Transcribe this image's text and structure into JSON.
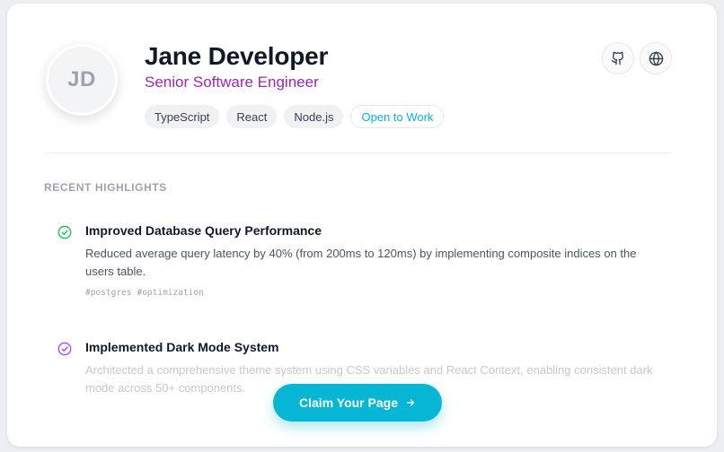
{
  "profile": {
    "initials": "JD",
    "name": "Jane Developer",
    "role": "Senior Software Engineer",
    "tags": [
      "TypeScript",
      "React",
      "Node.js"
    ],
    "status_tag": "Open to Work"
  },
  "links": {
    "github_icon": "github-icon",
    "website_icon": "globe-icon"
  },
  "highlights": {
    "section_title": "RECENT HIGHLIGHTS",
    "items": [
      {
        "title": "Improved Database Query Performance",
        "description": "Reduced average query latency by 40% (from 200ms to 120ms) by implementing composite indices on the users table.",
        "tags": [
          "#postgres",
          "#optimization"
        ],
        "check_color": "#22c55e"
      },
      {
        "title": "Implemented Dark Mode System",
        "description": "Architected a comprehensive theme system using CSS variables and React Context, enabling consistent dark mode across 50+ components.",
        "tags": [],
        "check_color": "#a855f7"
      }
    ]
  },
  "cta": {
    "label": "Claim Your Page",
    "icon": "arrow-right-icon"
  },
  "colors": {
    "accent": "#06b6d4",
    "role": "#9c27b0"
  }
}
